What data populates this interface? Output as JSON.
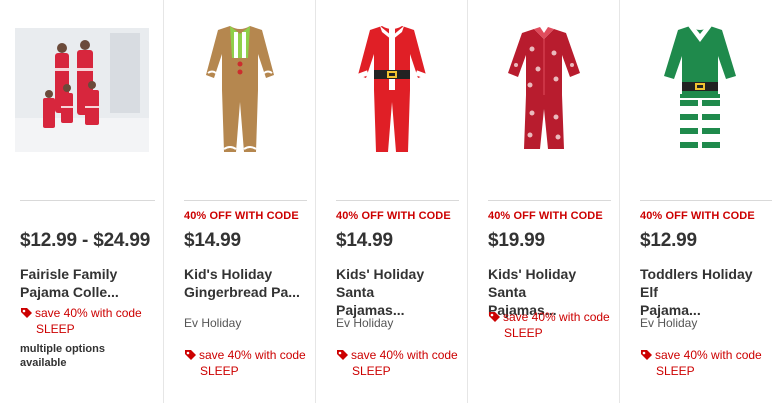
{
  "colors": {
    "promo": "#cc0000",
    "text": "#333333",
    "divider": "#d9d9d9"
  },
  "products": [
    {
      "promo": "",
      "price": "$12.99 - $24.99",
      "title_line1": "Fairisle Family",
      "title_line2": "Pajama Colle...",
      "brand": "",
      "save_text": "save 40% with code",
      "save_code": "SLEEP",
      "extra": "multiple options available",
      "image": "family-pajamas-photo"
    },
    {
      "promo": "40% OFF WITH CODE",
      "price": "$14.99",
      "title_line1": "Kid's Holiday",
      "title_line2": "Gingerbread Pa...",
      "brand": "Ev Holiday",
      "save_text": "save 40% with code",
      "save_code": "SLEEP",
      "image": "gingerbread-pajamas"
    },
    {
      "promo": "40% OFF WITH CODE",
      "price": "$14.99",
      "title_line1": "Kids' Holiday Santa",
      "title_line2": "Pajamas...",
      "brand": "Ev Holiday",
      "save_text": "save 40% with code",
      "save_code": "SLEEP",
      "image": "santa-pajamas"
    },
    {
      "promo": "40% OFF WITH CODE",
      "price": "$19.99",
      "title_line1": "Kids' Holiday Santa",
      "title_line2": "Pajamas...",
      "brand": "",
      "save_text": "save 40% with code",
      "save_code": "SLEEP",
      "image": "red-print-pajamas"
    },
    {
      "promo": "40% OFF WITH CODE",
      "price": "$12.99",
      "title_line1": "Toddlers Holiday Elf",
      "title_line2": "Pajama...",
      "brand": "Ev Holiday",
      "save_text": "save 40% with code",
      "save_code": "SLEEP",
      "image": "elf-pajamas"
    }
  ]
}
